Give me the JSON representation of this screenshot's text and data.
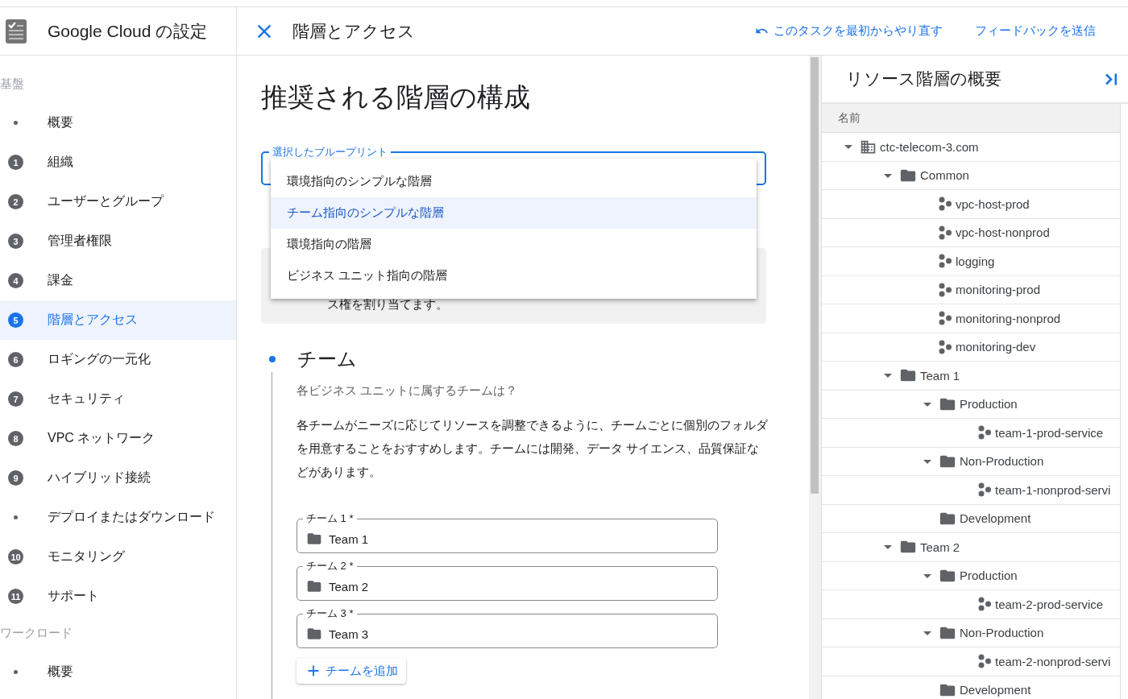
{
  "sidebar": {
    "title": "Google Cloud の設定",
    "sections": [
      {
        "label": "基盤",
        "items": [
          {
            "kind": "bullet",
            "label": "概要",
            "selected": false
          },
          {
            "kind": "step",
            "marker": "1",
            "label": "組織",
            "selected": false
          },
          {
            "kind": "step",
            "marker": "2",
            "label": "ユーザーとグループ",
            "selected": false
          },
          {
            "kind": "step",
            "marker": "3",
            "label": "管理者権限",
            "selected": false
          },
          {
            "kind": "step",
            "marker": "4",
            "label": "課金",
            "selected": false
          },
          {
            "kind": "step",
            "marker": "5",
            "label": "階層とアクセス",
            "selected": true
          },
          {
            "kind": "step",
            "marker": "6",
            "label": "ロギングの一元化",
            "selected": false
          },
          {
            "kind": "step",
            "marker": "7",
            "label": "セキュリティ",
            "selected": false
          },
          {
            "kind": "step",
            "marker": "8",
            "label": "VPC ネットワーク",
            "selected": false
          },
          {
            "kind": "step",
            "marker": "9",
            "label": "ハイブリッド接続",
            "selected": false
          },
          {
            "kind": "bullet",
            "label": "デプロイまたはダウンロード",
            "selected": false
          },
          {
            "kind": "step",
            "marker": "10",
            "label": "モニタリング",
            "selected": false
          },
          {
            "kind": "step",
            "marker": "11",
            "label": "サポート",
            "selected": false
          }
        ]
      },
      {
        "label": "ワークロード",
        "items": [
          {
            "kind": "bullet",
            "label": "概要",
            "selected": false
          }
        ]
      }
    ]
  },
  "header": {
    "title": "階層とアクセス",
    "links": [
      "このタスクを最初からやり直す",
      "フィードバックを送信"
    ]
  },
  "main": {
    "heading": "推奨される階層の構成",
    "blueprint_select": {
      "label": "選択したブループリント",
      "options": [
        {
          "label": "環境指向のシンプルな階層",
          "selected": false
        },
        {
          "label": "チーム指向のシンプルな階層",
          "selected": true
        },
        {
          "label": "環境指向の階層",
          "selected": false
        },
        {
          "label": "ビジネス ユニット指向の階層",
          "selected": false
        }
      ]
    },
    "info_text": "ス権を割り当てます。",
    "step": {
      "title": "チーム",
      "subtitle": "各ビジネス ユニットに属するチームは？",
      "description": "各チームがニーズに応じてリソースを調整できるように、チームごとに個別のフォルダを用意することをおすすめします。チームには開発、データ サイエンス、品質保証などがあります。",
      "fields": [
        {
          "label": "チーム 1 *",
          "value": "Team 1"
        },
        {
          "label": "チーム 2 *",
          "value": "Team 2"
        },
        {
          "label": "チーム 3 *",
          "value": "Team 3"
        }
      ],
      "add_button": "チームを追加"
    }
  },
  "resource_panel": {
    "title": "リソース階層の概要",
    "column": "名前",
    "tree": [
      {
        "kind": "org",
        "name": "ctc-telecom-3.com",
        "expanded": true,
        "children": [
          {
            "kind": "folder",
            "name": "Common",
            "expanded": true,
            "children": [
              {
                "kind": "project",
                "name": "vpc-host-prod"
              },
              {
                "kind": "project",
                "name": "vpc-host-nonprod"
              },
              {
                "kind": "project",
                "name": "logging"
              },
              {
                "kind": "project",
                "name": "monitoring-prod"
              },
              {
                "kind": "project",
                "name": "monitoring-nonprod"
              },
              {
                "kind": "project",
                "name": "monitoring-dev"
              }
            ]
          },
          {
            "kind": "folder",
            "name": "Team 1",
            "expanded": true,
            "children": [
              {
                "kind": "folder",
                "name": "Production",
                "expanded": true,
                "children": [
                  {
                    "kind": "project",
                    "name": "team-1-prod-service"
                  }
                ]
              },
              {
                "kind": "folder",
                "name": "Non-Production",
                "expanded": true,
                "children": [
                  {
                    "kind": "project",
                    "name": "team-1-nonprod-servi"
                  }
                ]
              },
              {
                "kind": "folder",
                "name": "Development"
              }
            ]
          },
          {
            "kind": "folder",
            "name": "Team 2",
            "expanded": true,
            "children": [
              {
                "kind": "folder",
                "name": "Production",
                "expanded": true,
                "children": [
                  {
                    "kind": "project",
                    "name": "team-2-prod-service"
                  }
                ]
              },
              {
                "kind": "folder",
                "name": "Non-Production",
                "expanded": true,
                "children": [
                  {
                    "kind": "project",
                    "name": "team-2-nonprod-servi"
                  }
                ]
              },
              {
                "kind": "folder",
                "name": "Development"
              }
            ]
          }
        ]
      }
    ]
  }
}
